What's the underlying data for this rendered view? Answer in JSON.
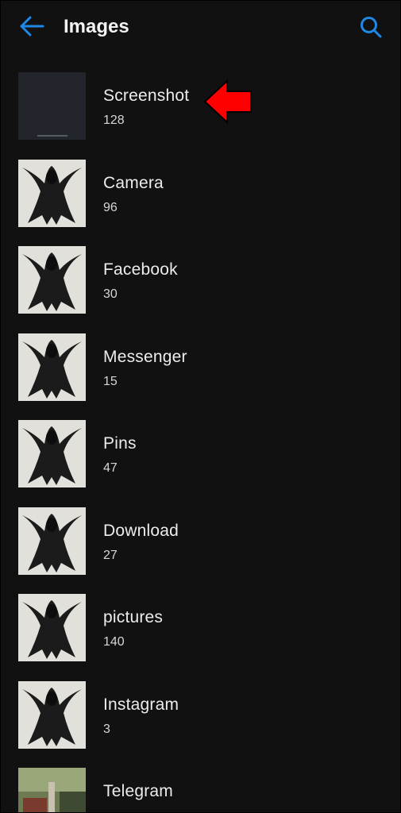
{
  "header": {
    "title": "Images",
    "back_icon": "arrow-left-icon",
    "search_icon": "search-icon",
    "accent_color": "#1e88e5"
  },
  "albums": [
    {
      "name": "Screenshot",
      "count": "128",
      "thumb": "dark"
    },
    {
      "name": "Camera",
      "count": "96",
      "thumb": "art"
    },
    {
      "name": "Facebook",
      "count": "30",
      "thumb": "art"
    },
    {
      "name": "Messenger",
      "count": "15",
      "thumb": "art"
    },
    {
      "name": "Pins",
      "count": "47",
      "thumb": "art"
    },
    {
      "name": "Download",
      "count": "27",
      "thumb": "art"
    },
    {
      "name": "pictures",
      "count": "140",
      "thumb": "art"
    },
    {
      "name": "Instagram",
      "count": "3",
      "thumb": "art"
    },
    {
      "name": "Telegram",
      "count": "",
      "thumb": "photo"
    }
  ],
  "annotation": {
    "icon": "red-arrow-left-icon",
    "color": "#ff0000"
  }
}
